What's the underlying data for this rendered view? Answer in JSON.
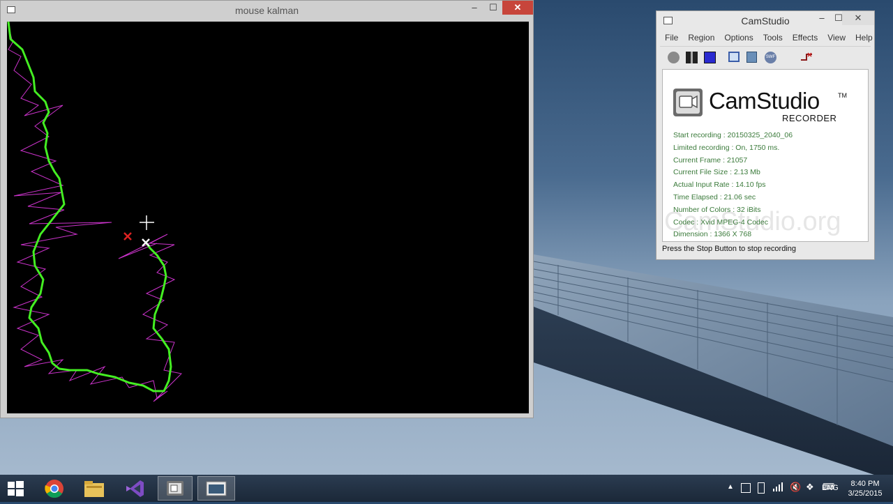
{
  "kalman_window": {
    "title": "mouse kalman",
    "minimize_label": "–",
    "maximize_label": "☐",
    "close_label": "✕"
  },
  "camstudio_window": {
    "title": "CamStudio",
    "minimize_label": "–",
    "maximize_label": "☐",
    "close_label": "✕",
    "menu": [
      "File",
      "Region",
      "Options",
      "Tools",
      "Effects",
      "View",
      "Help"
    ],
    "toolbar_icons": [
      "record-icon",
      "pause-icon",
      "stop-icon",
      "region-icon",
      "options-icon",
      "swf-icon",
      "autopan-icon"
    ],
    "brand": {
      "name": "CamStudio",
      "tm": "TM",
      "sub": "RECORDER"
    },
    "watermark": "CamStudio.org",
    "info_lines": [
      "Start recording : 20150325_2040_06",
      "Limited recording : On, 1750 ms.",
      "Current Frame : 21057",
      "Current File Size : 2.13 Mb",
      "Actual Input Rate : 14.10 fps",
      "Time Elapsed : 21.06 sec",
      "Number of Colors : 32 iBits",
      "Codec : Xvid MPEG-4 Codec",
      "Dimension : 1366 X 768"
    ],
    "status": "Press the Stop Button to stop recording"
  },
  "taskbar": {
    "apps": [
      "windows-start-icon",
      "chrome-icon",
      "file-explorer-icon",
      "visual-studio-icon",
      "camstudio-taskbar-icon",
      "kalman-app-icon"
    ],
    "language": "ENG",
    "time": "8:40 PM",
    "date": "3/25/2015"
  },
  "colors": {
    "measured_path": "#cc33cc",
    "kalman_path": "#44ee22",
    "marker_red": "#dd2222",
    "title_close": "#c7453b"
  }
}
